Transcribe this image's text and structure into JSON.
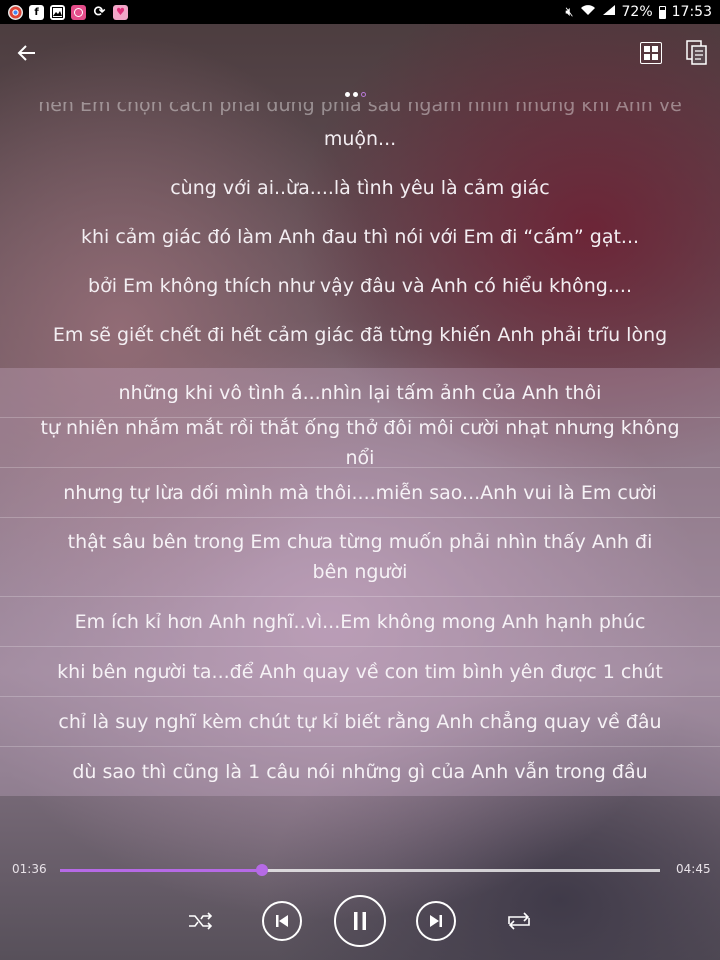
{
  "status_bar": {
    "battery_percent": "72%",
    "time": "17:53",
    "app_icons": [
      "chrome-icon",
      "facebook-icon",
      "gallery-icon",
      "camera-icon",
      "sync-icon",
      "heart-icon"
    ]
  },
  "top_bar": {
    "back_icon": "arrow-left-icon",
    "grid_icon": "grid-icon",
    "doc_icon": "copy-document-icon"
  },
  "lyrics": {
    "partial_top": "nên Em chọn cách phải đứng phía sau ngắm nhìn nhưng khi Anh về",
    "lines_plain": [
      "muộn...",
      "cùng với ai..ừa....là tình yêu là cảm giác",
      "khi cảm giác đó làm Anh đau thì nói với Em đi “cấm” gạt...",
      "bởi Em không thích như vậy đâu và Anh có hiểu không....",
      "Em sẽ giết chết đi hết cảm giác đã từng khiến Anh phải trĩu lòng"
    ],
    "lines_highlighted": [
      "những khi vô tình á...nhìn lại tấm ảnh của Anh thôi",
      "tự nhiên nhắm mắt rồi thắt ống thở đôi môi cười nhạt nhưng không nổi",
      "nhưng tự lừa dối mình mà thôi....miễn sao...Anh vui là Em cười",
      "thật sâu bên trong Em chưa từng muốn phải nhìn thấy Anh đi bên người",
      "Em ích kỉ hơn Anh nghĩ..vì...Em không mong Anh hạnh phúc",
      "khi bên người ta...để Anh quay về con tim bình yên được 1 chút",
      "chỉ là suy nghĩ kèm chút tự kỉ biết rằng Anh chẳng quay về đâu",
      "dù sao thì cũng là 1 câu nói những gì của Anh vẫn trong đầu"
    ]
  },
  "player": {
    "elapsed": "01:36",
    "total": "04:45",
    "progress_fraction": 0.337,
    "accent_color": "#b66ae6",
    "controls": [
      "shuffle-icon",
      "previous-icon",
      "pause-icon",
      "next-icon",
      "repeat-icon"
    ]
  }
}
